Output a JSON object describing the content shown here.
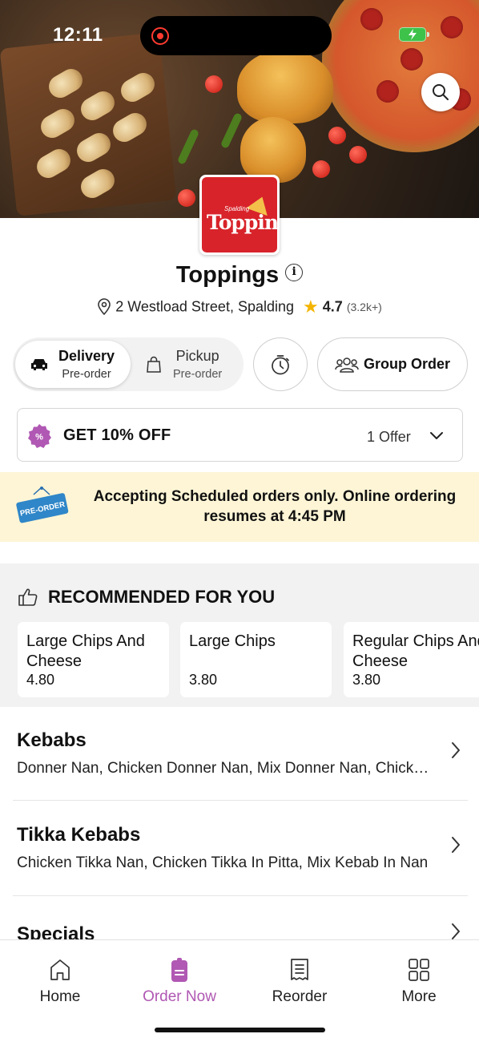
{
  "status_bar": {
    "time": "12:11"
  },
  "store": {
    "logo_small": "Spalding",
    "logo_main": "Toppings",
    "name": "Toppings",
    "address": "2 Westload Street, Spalding",
    "rating": "4.7",
    "reviews": "(3.2k+)"
  },
  "modes": {
    "delivery": {
      "title": "Delivery",
      "sub": "Pre-order"
    },
    "pickup": {
      "title": "Pickup",
      "sub": "Pre-order"
    },
    "group_order": "Group Order"
  },
  "offer": {
    "title": "GET 10% OFF",
    "count": "1 Offer"
  },
  "banner": {
    "tag": "PRE-ORDER",
    "text": "Accepting Scheduled orders only. Online ordering resumes at 4:45 PM"
  },
  "recommended": {
    "title": "RECOMMENDED FOR YOU",
    "items": [
      {
        "name": "Large Chips And Cheese",
        "price": "4.80"
      },
      {
        "name": "Large Chips",
        "price": "3.80"
      },
      {
        "name": "Regular Chips And Cheese",
        "price": "3.80"
      }
    ]
  },
  "categories": [
    {
      "title": "Kebabs",
      "desc": "Donner Nan, Chicken Donner Nan, Mix Donner Nan, Chicken Donner In Pitta"
    },
    {
      "title": "Tikka Kebabs",
      "desc": "Chicken Tikka Nan, Chicken Tikka In Pitta, Mix Kebab In Nan"
    },
    {
      "title": "Specials",
      "desc": ""
    }
  ],
  "tabs": [
    {
      "label": "Home",
      "icon": "home-icon"
    },
    {
      "label": "Order Now",
      "icon": "order-icon"
    },
    {
      "label": "Reorder",
      "icon": "receipt-icon"
    },
    {
      "label": "More",
      "icon": "grid-icon"
    }
  ],
  "colors": {
    "accent": "#b058b3",
    "banner_bg": "#fdf5d6",
    "star": "#f4b400",
    "logo_red": "#d8232a"
  }
}
